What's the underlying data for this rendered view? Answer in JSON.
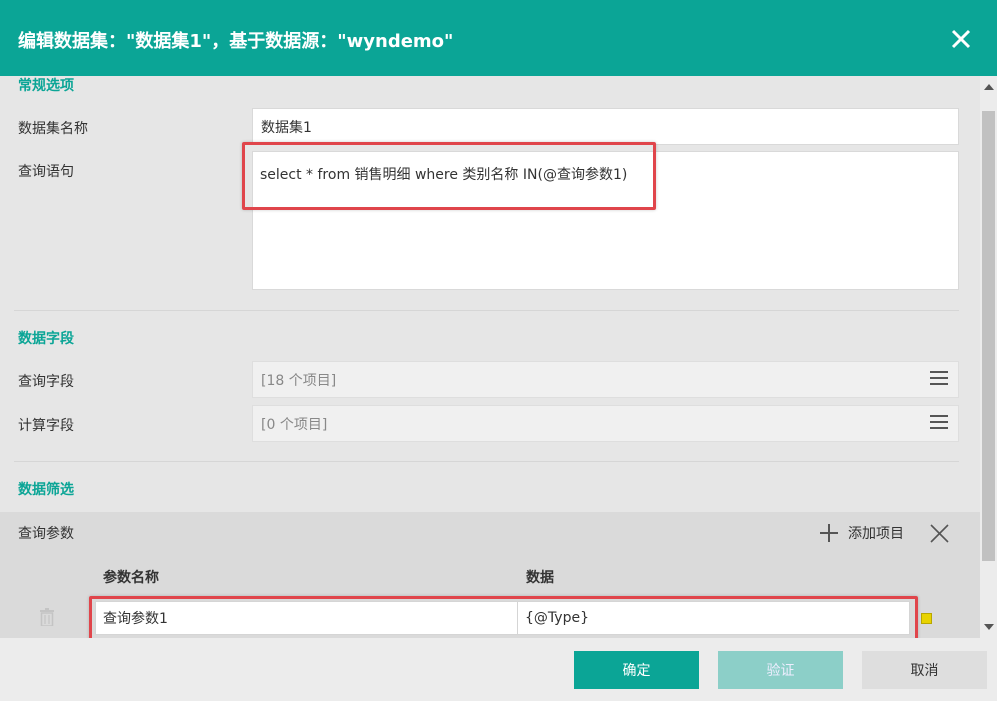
{
  "dialog": {
    "title": "编辑数据集：\"数据集1\"，基于数据源：\"wyndemo\""
  },
  "general": {
    "section_title": "常规选项",
    "name_label": "数据集名称",
    "name_value": "数据集1",
    "query_label": "查询语句",
    "query_value": "select * from 销售明细 where 类别名称 IN(@查询参数1)"
  },
  "fields": {
    "section_title": "数据字段",
    "query_fields_label": "查询字段",
    "query_fields_value": "[18 个项目]",
    "calc_fields_label": "计算字段",
    "calc_fields_value": "[0 个项目]"
  },
  "filter": {
    "section_title": "数据筛选"
  },
  "params": {
    "label": "查询参数",
    "add_label": "添加项目",
    "col_name": "参数名称",
    "col_data": "数据",
    "rows": [
      {
        "name": "查询参数1",
        "data": "{@Type}"
      }
    ]
  },
  "footer": {
    "ok_label": "确定",
    "validate_label": "验证",
    "cancel_label": "取消"
  },
  "colors": {
    "accent": "#0ba596",
    "highlight": "#e0454b"
  }
}
